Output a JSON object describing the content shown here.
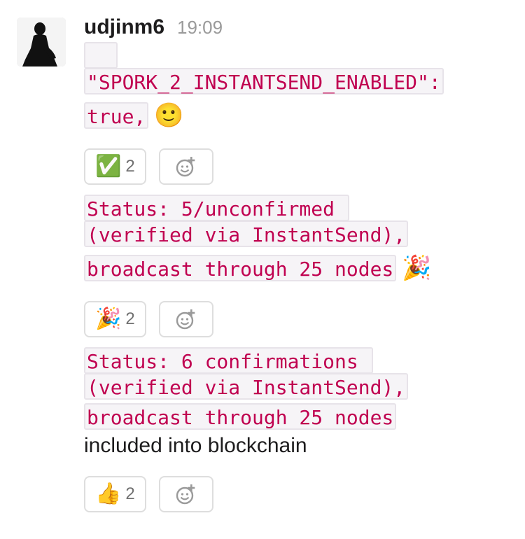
{
  "message": {
    "username": "udjinm6",
    "timestamp": "19:09",
    "block1": {
      "line1": "",
      "line2": "\"SPORK_2_INSTANTSEND_ENABLED\":",
      "line3": "true,",
      "emoji": "🙂"
    },
    "block2": {
      "line1": "Status: 5/unconfirmed ",
      "line2": "(verified via InstantSend),",
      "line3": "broadcast through 25 nodes",
      "emoji": "🎉"
    },
    "block3": {
      "line1": "Status: 6 confirmations ",
      "line2": "(verified via InstantSend),",
      "line3": "broadcast through 25 nodes",
      "plain": "included into blockchain"
    }
  },
  "reactions": [
    {
      "emoji": "✅",
      "count": "2"
    },
    {
      "emoji": "🎉",
      "count": "2"
    },
    {
      "emoji": "👍",
      "count": "2"
    }
  ],
  "icons": {
    "avatar": "person-silhouette",
    "add_reaction": "add-reaction-icon"
  }
}
